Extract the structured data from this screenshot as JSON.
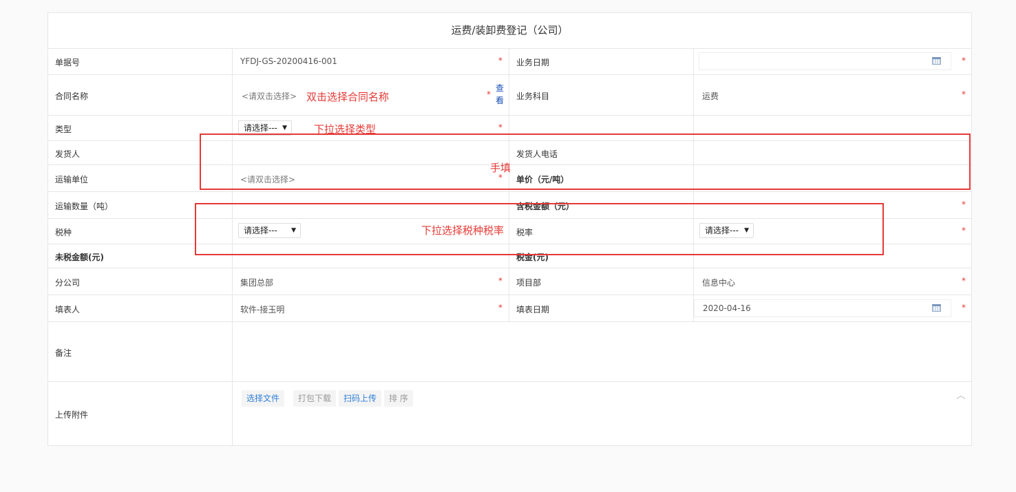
{
  "form": {
    "title": "运费/装卸费登记（公司）",
    "fields": {
      "doc_no": {
        "label": "单据号",
        "value": "YFDJ-GS-20200416-001"
      },
      "biz_date": {
        "label": "业务日期",
        "value": ""
      },
      "contract": {
        "label": "合同名称",
        "placeholder": "<请双击选择>",
        "view_link": "查看"
      },
      "subject": {
        "label": "业务科目",
        "value": "运费"
      },
      "type": {
        "label": "类型",
        "selected": "请选择---"
      },
      "shipper": {
        "label": "发货人"
      },
      "shipper_phone": {
        "label": "发货人电话"
      },
      "carrier": {
        "label": "运输单位",
        "placeholder": "<请双击选择>"
      },
      "unit_price": {
        "label": "单价（元/吨）"
      },
      "quantity": {
        "label": "运输数量（吨）"
      },
      "taxed_amount": {
        "label": "含税金额（元）"
      },
      "tax_type": {
        "label": "税种",
        "selected": "请选择---"
      },
      "tax_rate": {
        "label": "税率",
        "selected": "请选择---"
      },
      "untaxed_amount": {
        "label": "未税金额(元)"
      },
      "tax": {
        "label": "税金(元)"
      },
      "branch": {
        "label": "分公司",
        "value": "集团总部"
      },
      "project_dept": {
        "label": "项目部",
        "value": "信息中心"
      },
      "filler": {
        "label": "填表人",
        "value": "软件-接玉明"
      },
      "fill_date": {
        "label": "填表日期",
        "value": "2020-04-16"
      },
      "remark": {
        "label": "备注"
      },
      "attachment": {
        "label": "上传附件"
      }
    },
    "required_mark": "*",
    "buttons": {
      "choose_file": "选择文件",
      "pack_download": "打包下载",
      "scan_upload": "扫码上传",
      "sort": "排 序"
    },
    "collapse_icon": "chevron-up-icon"
  },
  "annotations": {
    "contract_hint": "双击选择合同名称",
    "type_hint": "下拉选择类型",
    "manual_hint": "手填",
    "tax_hint": "下拉选择税种税率"
  },
  "colors": {
    "accent_red": "#e53935",
    "link_blue": "#2f7fd6"
  }
}
